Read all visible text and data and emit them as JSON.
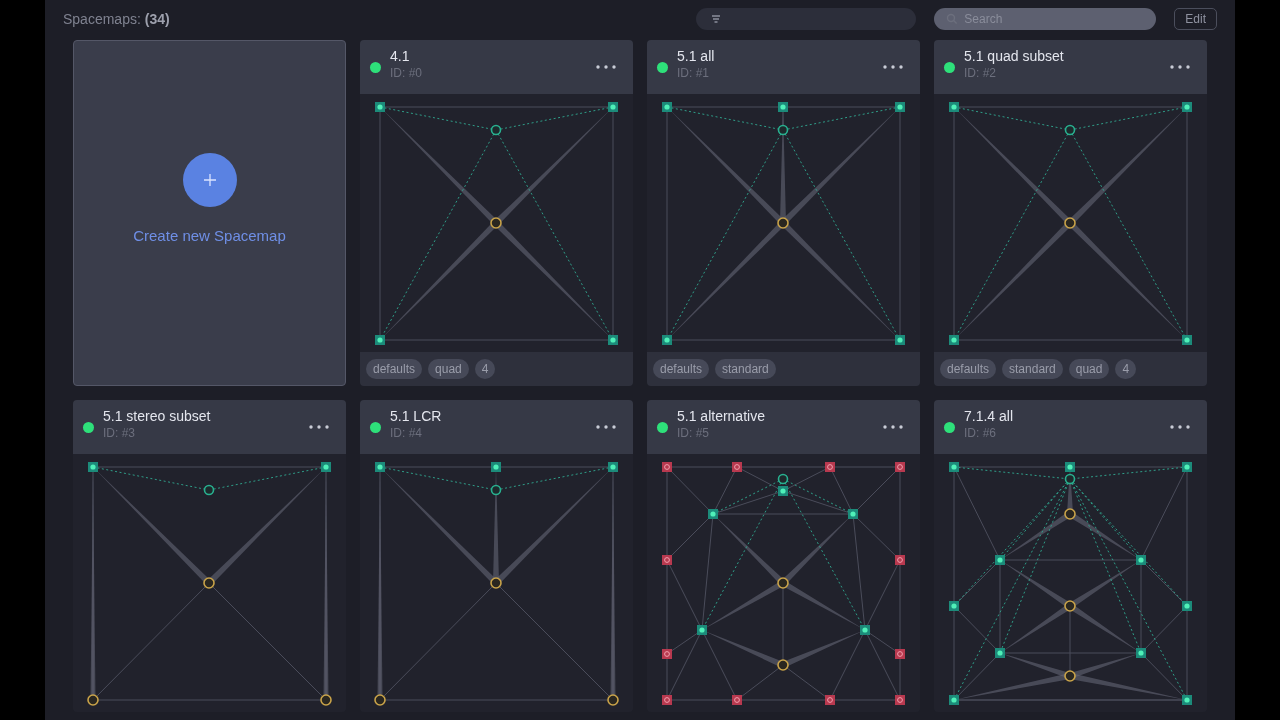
{
  "header": {
    "title": "Spacemaps:",
    "count": "(34)",
    "search": {
      "placeholder": "Search"
    },
    "edit_button": "Edit"
  },
  "create_card": {
    "label": "Create new Spacemap"
  },
  "spacemaps": [
    {
      "name": "4.1",
      "id": "ID: #0",
      "active": true,
      "kind": "quad",
      "tags": [
        "defaults",
        "quad",
        "4"
      ]
    },
    {
      "name": "5.1 all",
      "id": "ID: #1",
      "active": true,
      "kind": "quad_center",
      "tags": [
        "defaults",
        "standard"
      ]
    },
    {
      "name": "5.1 quad subset",
      "id": "ID: #2",
      "active": true,
      "kind": "quad",
      "tags": [
        "defaults",
        "standard",
        "quad",
        "4"
      ]
    },
    {
      "name": "5.1 stereo subset",
      "id": "ID: #3",
      "active": true,
      "kind": "stereo"
    },
    {
      "name": "5.1 LCR",
      "id": "ID: #4",
      "active": true,
      "kind": "lcr"
    },
    {
      "name": "5.1 alternative",
      "id": "ID: #5",
      "active": true,
      "kind": "alternative"
    },
    {
      "name": "7.1.4 all",
      "id": "ID: #6",
      "active": true,
      "kind": "immersive"
    }
  ]
}
